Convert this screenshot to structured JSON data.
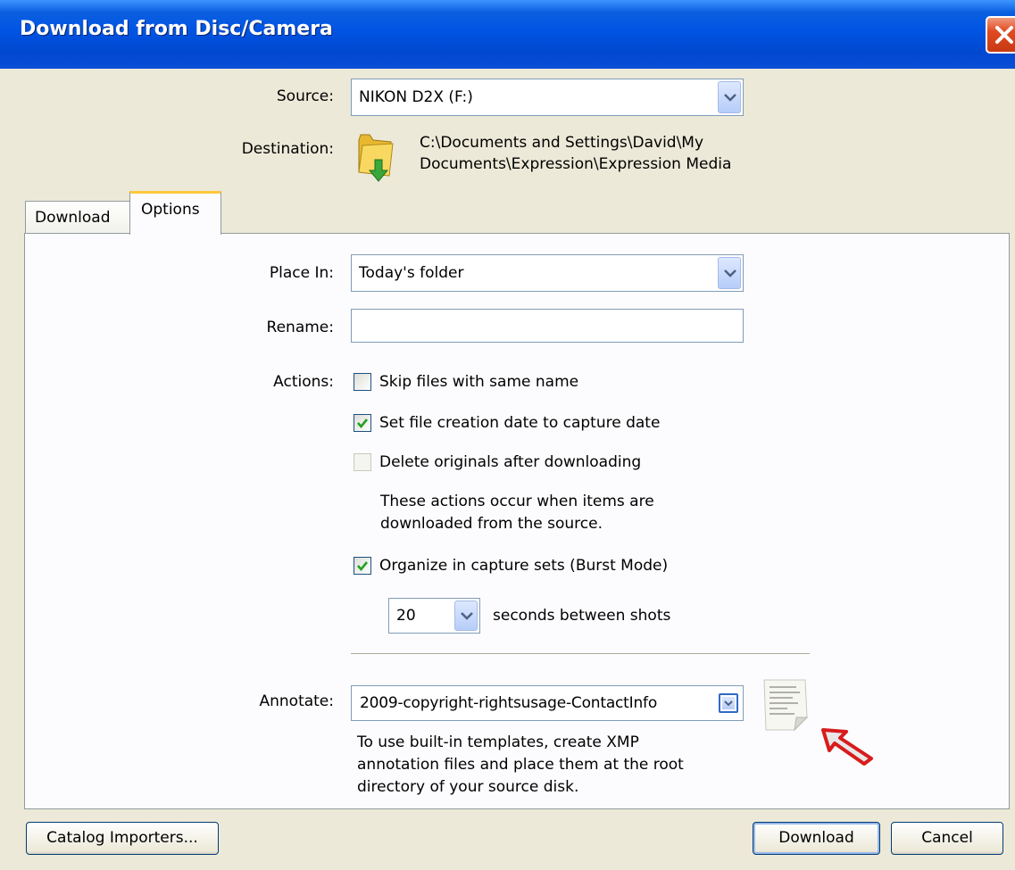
{
  "window": {
    "title": "Download from Disc/Camera"
  },
  "source": {
    "label": "Source:",
    "value": "NIKON D2X (F:)"
  },
  "destination": {
    "label": "Destination:",
    "path_line1": "C:\\Documents and Settings\\David\\My",
    "path_line2": "Documents\\Expression\\Expression Media"
  },
  "tabs": [
    {
      "label": "Download",
      "active": false
    },
    {
      "label": "Options",
      "active": true
    }
  ],
  "options": {
    "place_in": {
      "label": "Place In:",
      "value": "Today's folder"
    },
    "rename": {
      "label": "Rename:",
      "value": ""
    },
    "actions": {
      "label": "Actions:",
      "items": [
        {
          "label": "Skip files with same name",
          "checked": false,
          "enabled": true
        },
        {
          "label": "Set file creation date to capture date",
          "checked": true,
          "enabled": true
        },
        {
          "label": "Delete originals after downloading",
          "checked": false,
          "enabled": false
        }
      ],
      "note_line1": "These actions occur when items are",
      "note_line2": "downloaded from the source."
    },
    "burst": {
      "label": "Organize in capture sets (Burst Mode)",
      "checked": true,
      "seconds_value": "20",
      "seconds_label": "seconds between shots"
    },
    "annotate": {
      "label": "Annotate:",
      "value": "2009-copyright-rightsusage-ContactInfo",
      "hint_line1": "To use built-in templates, create XMP",
      "hint_line2": "annotation files and place them at the root",
      "hint_line3": "directory of your source disk."
    }
  },
  "buttons": {
    "catalog_importers": "Catalog Importers...",
    "download": "Download",
    "cancel": "Cancel"
  },
  "colors": {
    "title_bar": "#0054e3",
    "tab_highlight": "#ffc83c",
    "check_mark": "#21a121",
    "annotation_arrow": "#d81c1c"
  },
  "icons": [
    "close-icon",
    "folder-download-icon",
    "chevron-down-icon",
    "checkmark-icon",
    "document-template-icon",
    "red-arrow-icon"
  ]
}
